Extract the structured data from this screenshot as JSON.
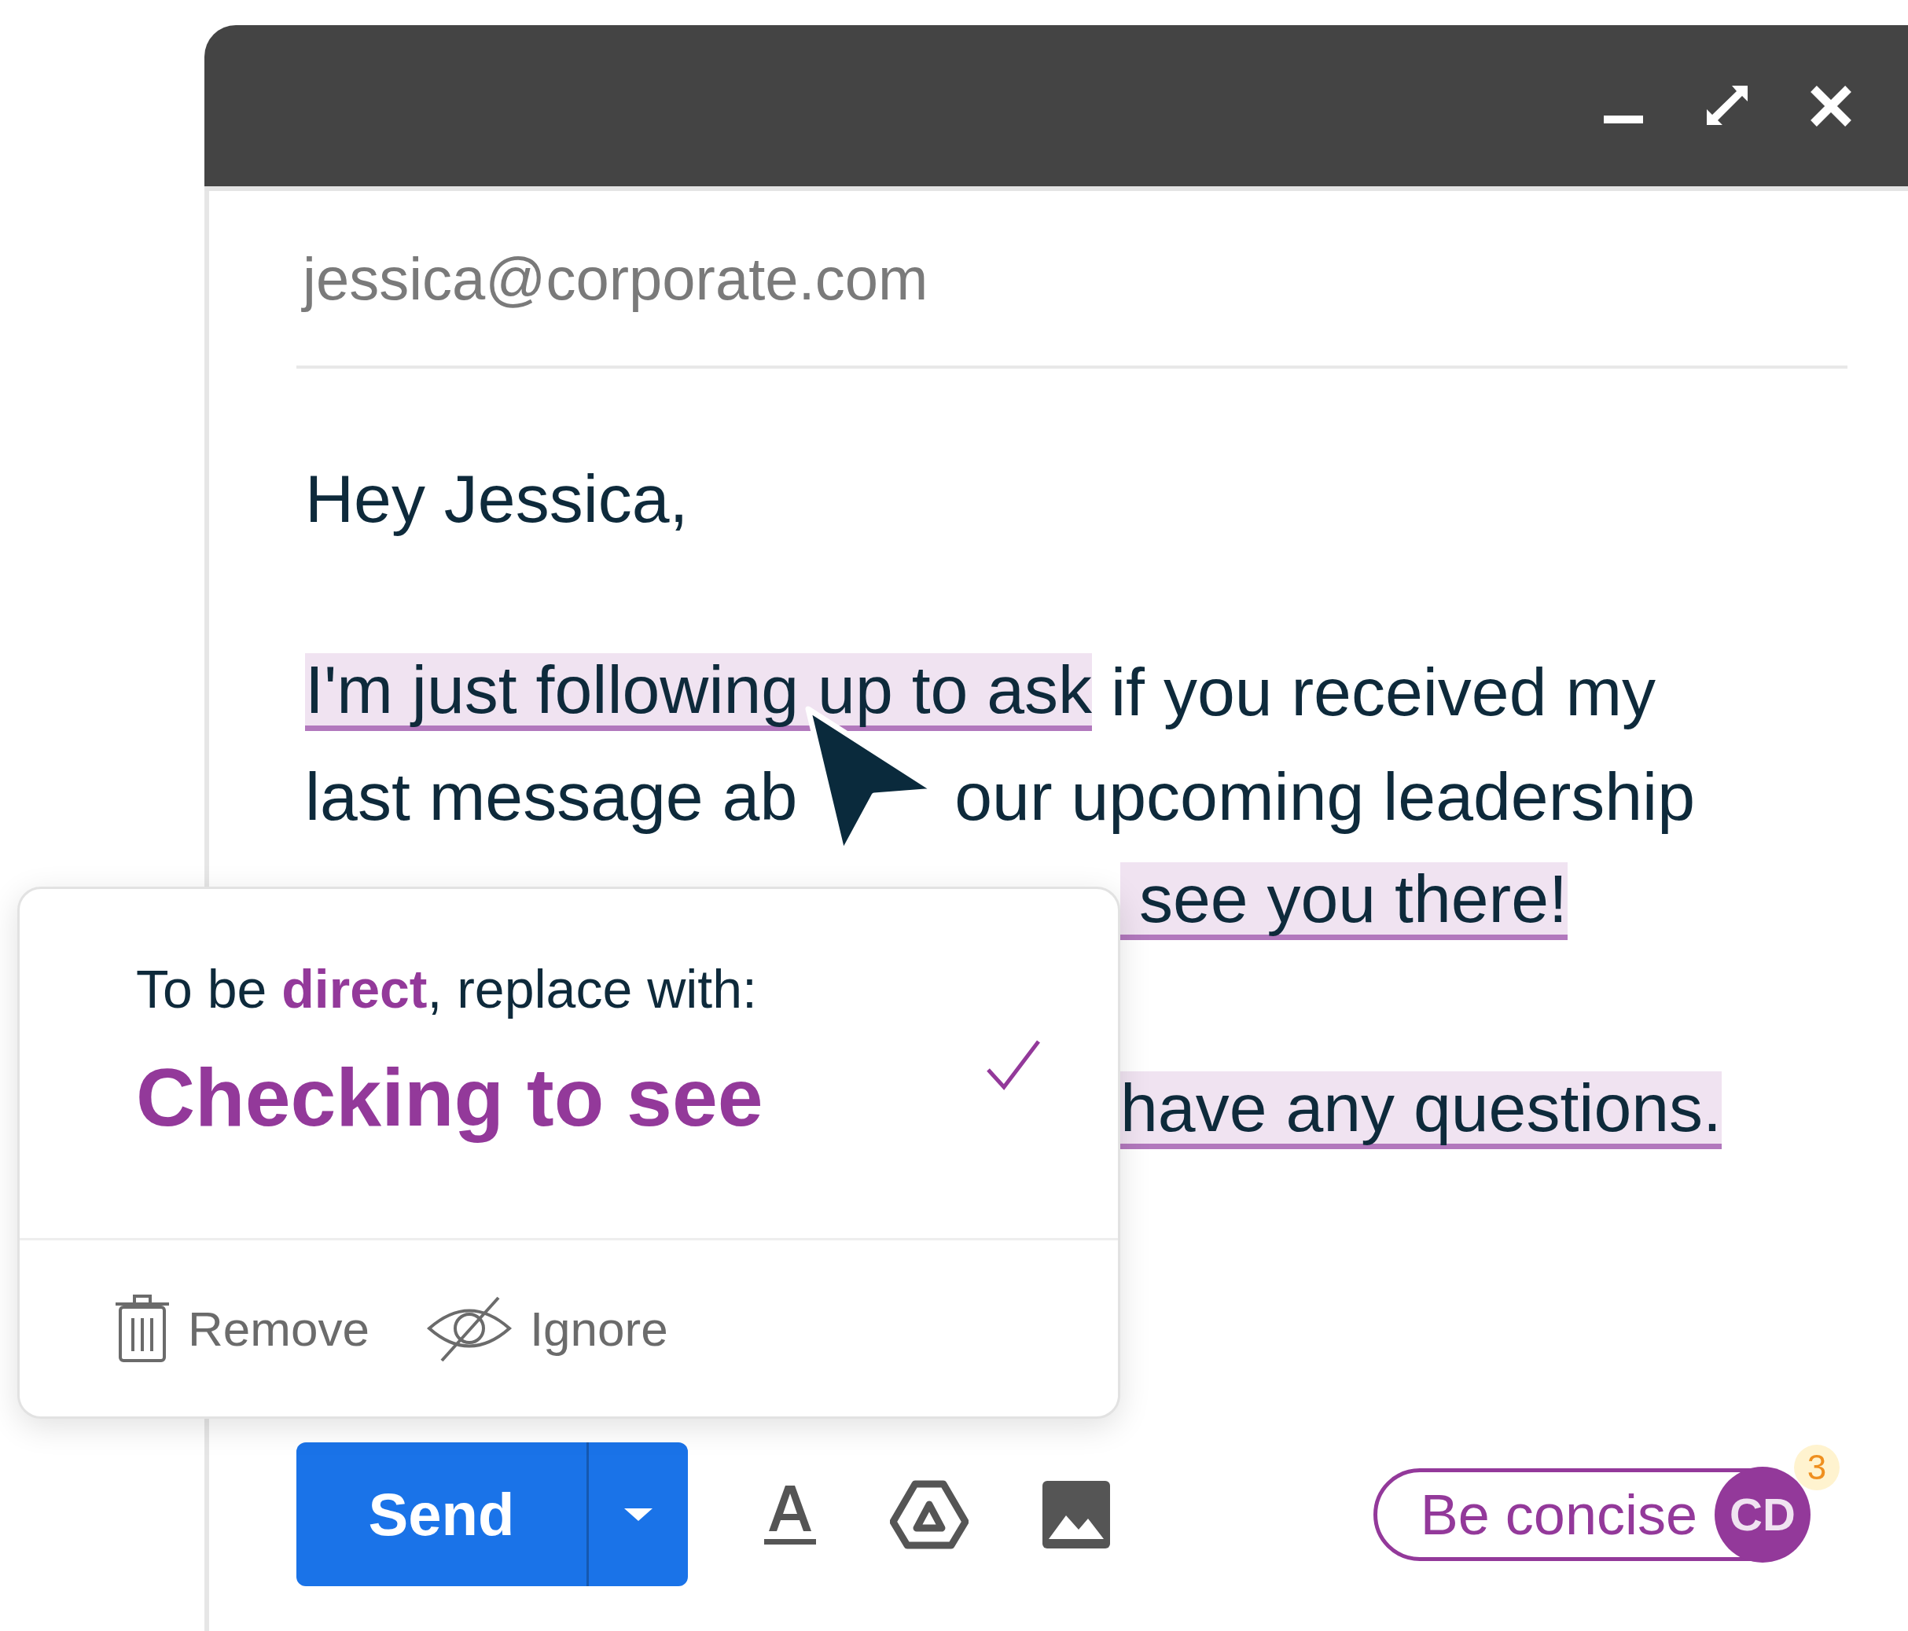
{
  "recipient": "jessica@corporate.com",
  "greeting": "Hey Jessica,",
  "body_lines": [
    {
      "hidden_start": false,
      "segments": [
        {
          "kind": "flagged",
          "text": "I'm just following up to ask"
        },
        {
          "kind": "plain",
          "text": " if you received my"
        }
      ]
    },
    {
      "hidden_start": false,
      "segments": [
        {
          "kind": "plain",
          "text": "last message ab"
        },
        {
          "kind": "pointer"
        },
        {
          "kind": "plain",
          "text": "our upcoming leadership"
        }
      ]
    },
    {
      "hidden_start": true,
      "segments": [
        {
          "kind": "flagged",
          "text": " see you there!"
        }
      ]
    },
    {
      "kind": "blank"
    },
    {
      "hidden_start": true,
      "segments": [
        {
          "kind": "flagged",
          "text": "have any questions."
        }
      ]
    }
  ],
  "suggestion": {
    "intro": "To be **direct**, replace with:",
    "replacement": "Checking to see",
    "actions": [
      {
        "kind": "remove",
        "label": "Remove"
      },
      {
        "kind": "ignore",
        "label": "Ignore"
      }
    ]
  },
  "toolbar": {
    "send_label": "Send"
  },
  "tone_chip": {
    "label": "Be concise",
    "avatar": "CD",
    "count": "3"
  }
}
